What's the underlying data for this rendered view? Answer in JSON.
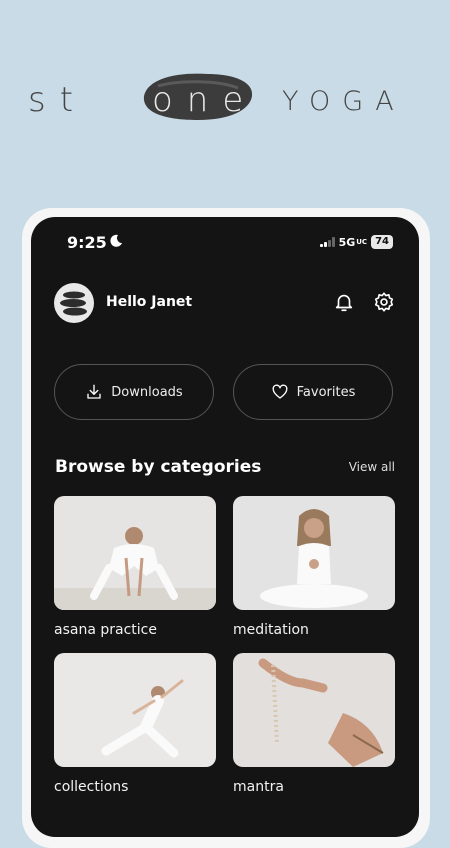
{
  "brand": {
    "part1": "st",
    "part_highlight": "one",
    "part2": "YOGA"
  },
  "status_bar": {
    "time": "9:25",
    "network": "5G",
    "network_suffix": "UC",
    "battery": "74"
  },
  "header": {
    "greeting": "Hello Janet"
  },
  "actions": {
    "downloads_label": "Downloads",
    "favorites_label": "Favorites"
  },
  "browse": {
    "title": "Browse by categories",
    "view_all": "View all",
    "categories": [
      {
        "label": "asana practice"
      },
      {
        "label": "meditation"
      },
      {
        "label": "collections"
      },
      {
        "label": "mantra"
      }
    ]
  },
  "colors": {
    "background": "#c8dbe6",
    "screen": "#141414",
    "text": "#ffffff"
  }
}
